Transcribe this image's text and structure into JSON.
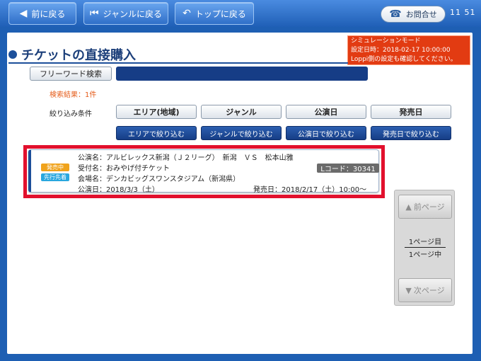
{
  "nav": {
    "back_label": "前に戻る",
    "back_icon": "arrow-left-icon",
    "genre_back_label": "ジャンルに戻る",
    "genre_back_icon": "skip-back-icon",
    "top_back_label": "トップに戻る",
    "top_back_icon": "return-icon",
    "inquiry_label": "お問合せ",
    "inquiry_icon": "phone-icon",
    "clock": "11 51"
  },
  "simulation": {
    "line1": "シミュレーションモード",
    "line2": "設定日時：2018-02-17 10:00:00",
    "line3": "Loppi側の設定も確認してください。"
  },
  "page": {
    "title": "チケットの直接購入"
  },
  "search": {
    "freeword_label": "フリーワード検索",
    "value": "",
    "result_count": "検索結果：1件"
  },
  "filters": {
    "label": "絞り込み条件",
    "buttons": [
      "エリア(地域)",
      "ジャンル",
      "公演日",
      "発売日"
    ],
    "narrow_buttons": [
      "エリアで絞り込む",
      "ジャンルで絞り込む",
      "公演日で絞り込む",
      "発売日で絞り込む"
    ]
  },
  "result": {
    "performance": "公演名：アルビレックス新潟（Ｊ２リーグ）　新潟　ＶＳ　松本山雅",
    "reception": "受付名：おみやげ付チケット",
    "venue": "会場名：デンカビッグスワンスタジアム（新潟県）",
    "date": "公演日：2018/3/3（土）",
    "release": "発売日：2018/2/17（土）10:00～",
    "lcode": "Lコード：30341",
    "badge_on_sale": "発売中",
    "badge_priority": "先行先着",
    "colors": {
      "on_sale": "#f0a31c",
      "priority": "#29a7de",
      "highlight": "#e2102d"
    }
  },
  "pager": {
    "prev_label": "前ページ",
    "next_label": "次ページ",
    "current": "1ページ目",
    "total": "1ページ中",
    "prev_icon": "triangle-up-icon",
    "next_icon": "triangle-down-icon"
  }
}
